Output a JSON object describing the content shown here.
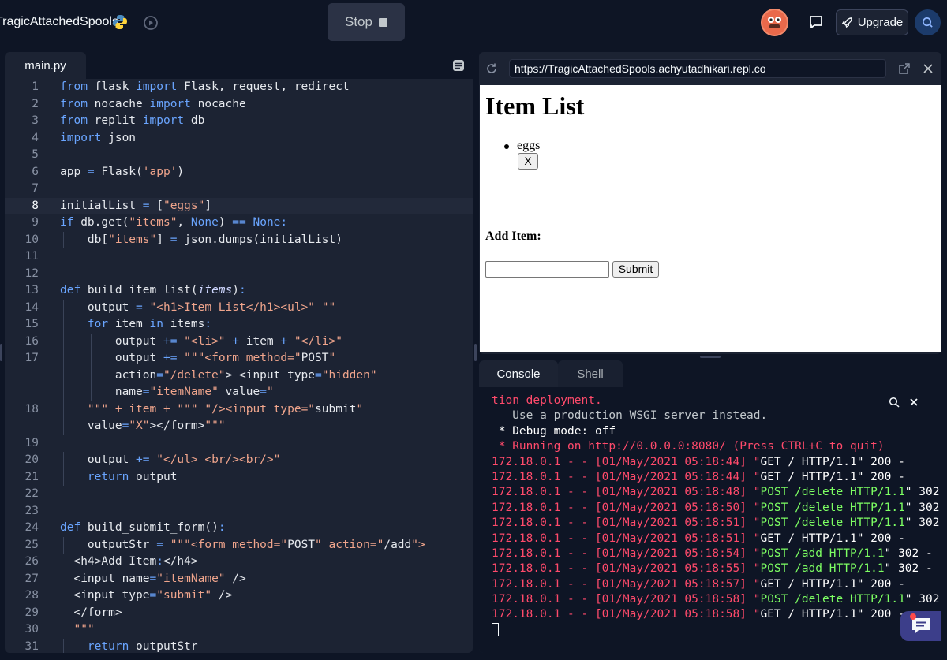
{
  "topbar": {
    "repl_name": "TragicAttachedSpools",
    "stop_label": "Stop",
    "upgrade_label": "Upgrade",
    "icons": [
      "python-icon",
      "history-icon",
      "chat-icon",
      "rocket-icon",
      "search-icon"
    ]
  },
  "editor": {
    "tab": "main.py",
    "active_line": 8,
    "lines": [
      {
        "n": "1",
        "code": "from flask import Flask, request, redirect"
      },
      {
        "n": "2",
        "code": "from nocache import nocache"
      },
      {
        "n": "3",
        "code": "from replit import db"
      },
      {
        "n": "4",
        "code": "import json"
      },
      {
        "n": "5",
        "code": ""
      },
      {
        "n": "6",
        "code": "app = Flask('app')"
      },
      {
        "n": "7",
        "code": ""
      },
      {
        "n": "8",
        "code": "initialList = [\"eggs\"]"
      },
      {
        "n": "9",
        "code": "if db.get(\"items\", None) == None:"
      },
      {
        "n": "10",
        "code": "    db[\"items\"] = json.dumps(initialList)"
      },
      {
        "n": "11",
        "code": ""
      },
      {
        "n": "12",
        "code": ""
      },
      {
        "n": "13",
        "code": "def build_item_list(items):"
      },
      {
        "n": "14",
        "code": "    output = \"<h1>Item List</h1><ul>\" \"\""
      },
      {
        "n": "15",
        "code": "    for item in items:"
      },
      {
        "n": "16",
        "code": "        output += \"<li>\" + item + \"</li>\""
      },
      {
        "n": "17",
        "code": "        output += \"\"\"<form method=\"POST\""
      },
      {
        "n": "",
        "code": "        action=\"/delete\"> <input type=\"hidden\""
      },
      {
        "n": "",
        "code": "        name=\"itemName\" value=\""
      },
      {
        "n": "18",
        "code": "    \"\"\" + item + \"\"\" \"/><input type=\"submit\""
      },
      {
        "n": "",
        "code": "    value=\"X\"></form>\"\"\""
      },
      {
        "n": "19",
        "code": ""
      },
      {
        "n": "20",
        "code": "    output += \"</ul> <br/><br/>\""
      },
      {
        "n": "21",
        "code": "    return output"
      },
      {
        "n": "22",
        "code": ""
      },
      {
        "n": "23",
        "code": ""
      },
      {
        "n": "24",
        "code": "def build_submit_form():"
      },
      {
        "n": "25",
        "code": "    outputStr = \"\"\"<form method=\"POST\" action=\"/add\">"
      },
      {
        "n": "26",
        "code": "  <h4>Add Item:</h4>"
      },
      {
        "n": "27",
        "code": "  <input name=\"itemName\" />"
      },
      {
        "n": "28",
        "code": "  <input type=\"submit\" />"
      },
      {
        "n": "29",
        "code": "  </form>"
      },
      {
        "n": "30",
        "code": "  \"\"\""
      },
      {
        "n": "31",
        "code": "    return outputStr"
      }
    ]
  },
  "webview": {
    "url": "https://TragicAttachedSpools.achyutadhikari.repl.co",
    "heading": "Item List",
    "items": [
      "eggs"
    ],
    "delete_label": "X",
    "form_heading": "Add Item:",
    "input_value": "",
    "submit_label": "Submit"
  },
  "console": {
    "tabs": [
      "Console",
      "Shell"
    ],
    "lines": [
      {
        "parts": [
          {
            "t": "tion deployment.",
            "c": "red"
          }
        ]
      },
      {
        "parts": [
          {
            "t": "   Use a production WSGI server instead.",
            "c": "gray"
          }
        ]
      },
      {
        "parts": [
          {
            "t": " * Debug mode: off",
            "c": "white"
          }
        ]
      },
      {
        "parts": [
          {
            "t": " * Running on http://0.0.0.0:8080/ (Press CTRL+C to quit)",
            "c": "red"
          }
        ]
      },
      {
        "parts": [
          {
            "t": "172.18.0.1 - - [01/May/2021 05:18:44] \"",
            "c": "red"
          },
          {
            "t": "GET / HTTP/1.1",
            "c": "white"
          },
          {
            "t": "\" 200 -",
            "c": "white"
          }
        ]
      },
      {
        "parts": [
          {
            "t": "172.18.0.1 - - [01/May/2021 05:18:44] \"",
            "c": "red"
          },
          {
            "t": "GET / HTTP/1.1",
            "c": "white"
          },
          {
            "t": "\" 200 -",
            "c": "white"
          }
        ]
      },
      {
        "parts": [
          {
            "t": "172.18.0.1 - - [01/May/2021 05:18:48] \"",
            "c": "red"
          },
          {
            "t": "POST /delete HTTP/1.1",
            "c": "green"
          },
          {
            "t": "\" 302 -",
            "c": "white"
          }
        ]
      },
      {
        "parts": [
          {
            "t": "172.18.0.1 - - [01/May/2021 05:18:50] \"",
            "c": "red"
          },
          {
            "t": "POST /delete HTTP/1.1",
            "c": "green"
          },
          {
            "t": "\" 302 -",
            "c": "white"
          }
        ]
      },
      {
        "parts": [
          {
            "t": "172.18.0.1 - - [01/May/2021 05:18:51] \"",
            "c": "red"
          },
          {
            "t": "POST /delete HTTP/1.1",
            "c": "green"
          },
          {
            "t": "\" 302 -",
            "c": "white"
          }
        ]
      },
      {
        "parts": [
          {
            "t": "172.18.0.1 - - [01/May/2021 05:18:51] \"",
            "c": "red"
          },
          {
            "t": "GET / HTTP/1.1",
            "c": "white"
          },
          {
            "t": "\" 200 -",
            "c": "white"
          }
        ]
      },
      {
        "parts": [
          {
            "t": "172.18.0.1 - - [01/May/2021 05:18:54] \"",
            "c": "red"
          },
          {
            "t": "POST /add HTTP/1.1",
            "c": "green"
          },
          {
            "t": "\" 302 -",
            "c": "white"
          }
        ]
      },
      {
        "parts": [
          {
            "t": "172.18.0.1 - - [01/May/2021 05:18:55] \"",
            "c": "red"
          },
          {
            "t": "POST /add HTTP/1.1",
            "c": "green"
          },
          {
            "t": "\" 302 -",
            "c": "white"
          }
        ]
      },
      {
        "parts": [
          {
            "t": "172.18.0.1 - - [01/May/2021 05:18:57] \"",
            "c": "red"
          },
          {
            "t": "GET / HTTP/1.1",
            "c": "white"
          },
          {
            "t": "\" 200 -",
            "c": "white"
          }
        ]
      },
      {
        "parts": [
          {
            "t": "172.18.0.1 - - [01/May/2021 05:18:58] \"",
            "c": "red"
          },
          {
            "t": "POST /delete HTTP/1.1",
            "c": "green"
          },
          {
            "t": "\" 302 -",
            "c": "white"
          }
        ]
      },
      {
        "parts": [
          {
            "t": "172.18.0.1 - - [01/May/2021 05:18:58] \"",
            "c": "red"
          },
          {
            "t": "GET / HTTP/1.1",
            "c": "white"
          },
          {
            "t": "\" 200 -",
            "c": "white"
          }
        ]
      }
    ]
  },
  "colors": {
    "bg": "#0e1525",
    "panel": "#1c2333",
    "accent_blue": "#6aa5ff",
    "string": "#f0a58c",
    "console_red": "#ff4a6b",
    "console_green": "#7dff63"
  }
}
